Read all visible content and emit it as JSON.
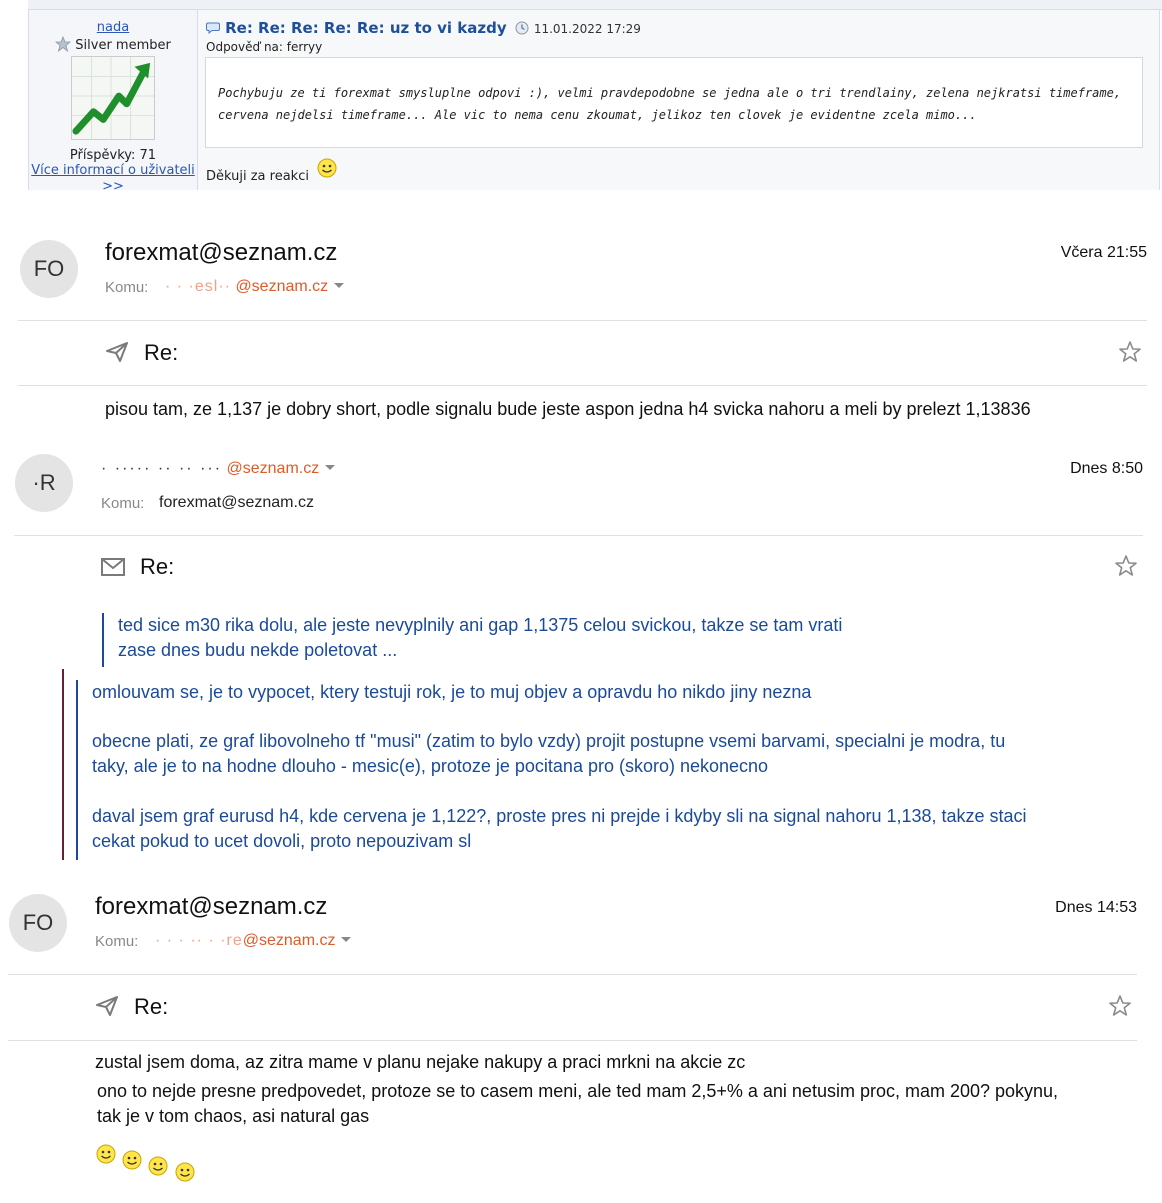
{
  "forum_post": {
    "username": "nada",
    "rank": "Silver member",
    "posts_label": "Příspěvky: 71",
    "more_info": "Více informací o uživateli >>",
    "title": "Re: Re: Re: Re: Re: uz to vi kazdy",
    "date": "11.01.2022 17:29",
    "reply_to": "Odpověď na: ferryy",
    "quote": "Pochybuju ze ti forexmat smysluplne odpovi :), velmi pravdepodobne se jedna ale o tri trendlainy, zelena nejkratsi timeframe, cervena nejdelsi timeframe... Ale vic to nema cenu zkoumat, jelikoz ten clovek je evidentne zcela mimo...",
    "thanks": "Děkuji za reakci"
  },
  "emails": [
    {
      "avatar": "FO",
      "from": "forexmat@seznam.cz",
      "time": "Včera 21:55",
      "to_label": "Komu:",
      "to_redacted": "· · ·esl··",
      "to_domain": "@seznam.cz",
      "subject": "Re:",
      "body": "pisou tam, ze 1,137 je dobry short, podle signalu bude jeste aspon jedna h4 svicka nahoru a meli by prelezt 1,13836"
    },
    {
      "avatar": "·R",
      "from_redacted": "· ·····   ··   ·· ···",
      "from_domain": "@seznam.cz",
      "time": "Dnes 8:50",
      "to_label": "Komu:",
      "to": "forexmat@seznam.cz",
      "subject": "Re:",
      "quote_inner": "ted sice m30 rika dolu, ale jeste nevyplnily ani gap 1,1375 celou svickou, takze se tam vrati\nzase dnes budu nekde poletovat ...",
      "quote_p1": "omlouvam se, je to vypocet, ktery testuji  rok,  je to muj objev a opravdu ho nikdo jiny nezna",
      "quote_p2": "obecne plati, ze graf libovolneho tf  \"musi\" (zatim to bylo vzdy) projit postupne vsemi barvami, specialni je modra, tu\ntaky, ale je to na hodne dlouho - mesic(e), protoze je pocitana pro (skoro) nekonecno",
      "quote_p3": "daval jsem graf eurusd h4, kde cervena je 1,122?, proste pres ni prejde i kdyby sli na signal nahoru 1,138, takze staci\ncekat pokud to ucet dovoli, proto nepouzivam sl"
    },
    {
      "avatar": "FO",
      "from": "forexmat@seznam.cz",
      "time": "Dnes 14:53",
      "to_label": "Komu:",
      "to_redacted": "· ·  · ··  · ·re",
      "to_domain": "@seznam.cz",
      "subject": "Re:",
      "body_line1": "zustal jsem doma, az zitra mame v planu nejake nakupy a praci  mrkni na akcie zc",
      "body_line2": "ono to nejde presne predpovedet, protoze se to casem meni, ale ted mam 2,5+% a ani netusim proc, mam 200? pokynu,\ntak je v tom chaos, asi natural gas"
    }
  ],
  "colors": {
    "link_blue": "#2a57b5",
    "quote_blue": "#1a4a9b",
    "email_orange": "#e05a26"
  },
  "icons": [
    "star-icon",
    "avatar-chart-icon",
    "speech-bubble-icon",
    "clock-icon",
    "smiley-icon",
    "send-icon",
    "envelope-icon",
    "favorite-star-icon",
    "chevron-down-icon"
  ]
}
